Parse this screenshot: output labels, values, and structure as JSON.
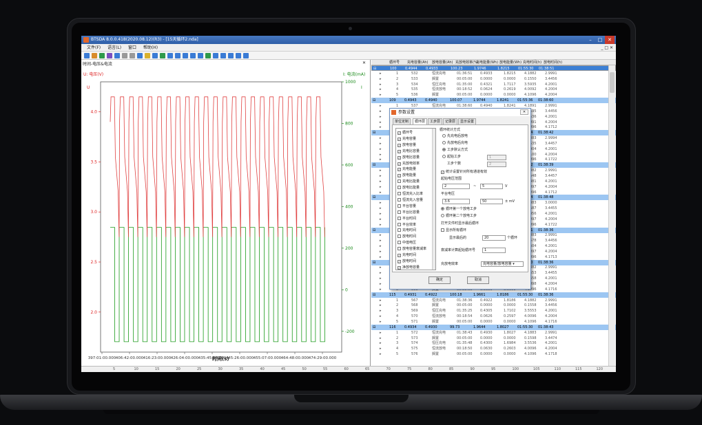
{
  "app": {
    "title": "BTSDA 8.0.0.418(2020.08.12)(R3) - [15天循环2.nda]"
  },
  "window_controls": {
    "minimize": "–",
    "maximize": "□",
    "close": "✕"
  },
  "menu": {
    "items": [
      "文件(F)",
      "语言(L)",
      "窗口",
      "帮助(H)"
    ],
    "right": "_ □ ✕"
  },
  "left_panel": {
    "tab_title": "时间-电压&电流",
    "close": "✕",
    "legend_left": "U: 电压(V)",
    "legend_right": "I: 电流(mA)",
    "x_title": "时间(s)"
  },
  "chart_data": [
    {
      "type": "line",
      "xlabel": "时间(s)",
      "x_ticks": [
        "397:01:00.000",
        "406:42:00.000",
        "416:23:00.000",
        "426:04:00.000",
        "435:45:00.000",
        "445:26:00.000",
        "455:07:00.000",
        "464:48:00.000",
        "474:29:00.000"
      ],
      "y_left_ticks": [
        "4.0",
        "3.5",
        "3.0",
        "2.5",
        "2.0"
      ],
      "y_left_axis_label": "U",
      "y_left_range": [
        1.6,
        4.3
      ],
      "y_right_ticks": [
        "1000",
        "800",
        "600",
        "400",
        "200",
        "0",
        "-200"
      ],
      "y_right_axis_label": "I",
      "y_right_range": [
        -300,
        1000
      ],
      "series": [
        {
          "name": "电压(V)",
          "color": "#e04040",
          "axis": "left",
          "cycles": 23,
          "max": 4.15,
          "min": 2.75
        },
        {
          "name": "电流(mA)",
          "color": "#1a9a1a",
          "axis": "right",
          "cycles": 23,
          "high": 300,
          "low": -250
        }
      ],
      "grid": false
    }
  ],
  "table": {
    "headers": [
      "循环号",
      "充电容量(Ah)",
      "放电容量(Ah)",
      "充放电效率(%)",
      "充电能量(Wh)",
      "放电能量(Wh)",
      "充电时间(h)",
      "放电时间(h)"
    ],
    "rows": [
      {
        "kind": "cycle",
        "sel": true,
        "c": [
          "100",
          "0.4944",
          "0.4933",
          "100.23",
          "1.9746",
          "1.8215",
          "01:55:30",
          "01:38:51"
        ]
      },
      {
        "kind": "step",
        "c": [
          "1",
          "532",
          "恒流充电",
          "01:36:51",
          "0.4933",
          "1.8215",
          "4.1882",
          "2.9991"
        ]
      },
      {
        "kind": "step",
        "c": [
          "2",
          "533",
          "搁置",
          "00:05:00",
          "0.0000",
          "0.0000",
          "0.1550",
          "3.4456"
        ]
      },
      {
        "kind": "step",
        "c": [
          "3",
          "534",
          "恒压充电",
          "01:35:00",
          "0.4321",
          "1.7117",
          "3.5935",
          "4.2001"
        ]
      },
      {
        "kind": "step",
        "c": [
          "4",
          "535",
          "恒流放电",
          "00:18:52",
          "0.0624",
          "0.2619",
          "4.0092",
          "4.2004"
        ]
      },
      {
        "kind": "step",
        "c": [
          "5",
          "536",
          "搁置",
          "00:05:00",
          "0.0000",
          "0.0000",
          "4.1096",
          "4.2004"
        ]
      },
      {
        "kind": "cycle",
        "c": [
          "109",
          "0.4943",
          "0.4940",
          "100.07",
          "1.9744",
          "1.8241",
          "01:55:36",
          "01:38:60"
        ]
      },
      {
        "kind": "step",
        "c": [
          "1",
          "537",
          "恒流充电",
          "01:38:60",
          "0.4940",
          "1.8241",
          "4.1891",
          "2.9991"
        ]
      },
      {
        "kind": "step",
        "c": [
          "2",
          "538",
          "搁置",
          "00:05:00",
          "0.0000",
          "0.0000",
          "0.1595",
          "3.4456"
        ]
      },
      {
        "kind": "step",
        "c": [
          "3",
          "539",
          "恒压充电",
          "01:35:30",
          "0.4316",
          "1.7114",
          "3.5536",
          "4.2001"
        ]
      },
      {
        "kind": "step",
        "c": [
          "4",
          "540",
          "恒流放电",
          "00:18:55",
          "0.0627",
          "0.2630",
          "4.0091",
          "4.2004"
        ]
      },
      {
        "kind": "step",
        "c": [
          "5",
          "541",
          "搁置",
          "00:05:00",
          "0.0000",
          "0.0000",
          "4.1096",
          "4.1712"
        ]
      },
      {
        "kind": "cycle",
        "c": [
          "110",
          "0.4942",
          "0.4938",
          "100.08",
          "1.9743",
          "1.8240",
          "01:55:24",
          "01:38:42"
        ]
      },
      {
        "kind": "step",
        "c": [
          "1",
          "542",
          "恒流充电",
          "01:38:42",
          "0.4938",
          "1.8240",
          "4.1883",
          "2.9994"
        ]
      },
      {
        "kind": "step",
        "c": [
          "2",
          "543",
          "搁置",
          "00:05:00",
          "0.0000",
          "0.0000",
          "0.1535",
          "3.4457"
        ]
      },
      {
        "kind": "step",
        "c": [
          "3",
          "544",
          "恒压充电",
          "01:35:12",
          "0.4315",
          "1.7111",
          "3.5404",
          "4.2001"
        ]
      },
      {
        "kind": "step",
        "c": [
          "4",
          "545",
          "恒流放电",
          "00:18:54",
          "0.0627",
          "0.2615",
          "4.0100",
          "4.2004"
        ]
      },
      {
        "kind": "step",
        "c": [
          "5",
          "546",
          "搁置",
          "00:05:00",
          "0.0000",
          "0.0000",
          "4.1096",
          "4.1722"
        ]
      },
      {
        "kind": "cycle",
        "c": [
          "111",
          "0.4939",
          "0.4935",
          "100.08",
          "1.9740",
          "1.8230",
          "01:55:22",
          "01:38:39"
        ]
      },
      {
        "kind": "step",
        "c": [
          "1",
          "547",
          "恒流充电",
          "01:38:39",
          "0.4935",
          "1.8230",
          "4.1882",
          "2.9991"
        ]
      },
      {
        "kind": "step",
        "c": [
          "2",
          "548",
          "搁置",
          "00:05:00",
          "0.0000",
          "0.0000",
          "0.1548",
          "3.4457"
        ]
      },
      {
        "kind": "step",
        "c": [
          "3",
          "549",
          "恒压充电",
          "01:35:10",
          "0.4313",
          "1.7117",
          "3.5481",
          "4.2001"
        ]
      },
      {
        "kind": "step",
        "c": [
          "4",
          "550",
          "恒流放电",
          "00:18:48",
          "0.0625",
          "0.2617",
          "4.0097",
          "4.2004"
        ]
      },
      {
        "kind": "step",
        "c": [
          "5",
          "551",
          "搁置",
          "00:05:00",
          "0.0000",
          "0.0000",
          "4.1096",
          "4.1712"
        ]
      },
      {
        "kind": "cycle",
        "c": [
          "112",
          "0.4936",
          "0.4934",
          "100.04",
          "1.9738",
          "1.8226",
          "01:55:24",
          "01:38:48"
        ]
      },
      {
        "kind": "step",
        "c": [
          "1",
          "552",
          "恒流充电",
          "01:38:48",
          "0.4934",
          "1.8226",
          "4.1883",
          "3.0000"
        ]
      },
      {
        "kind": "step",
        "c": [
          "2",
          "553",
          "搁置",
          "00:05:00",
          "0.0000",
          "0.0000",
          "0.1587",
          "3.4455"
        ]
      },
      {
        "kind": "step",
        "c": [
          "3",
          "554",
          "恒压充电",
          "01:35:12",
          "0.4310",
          "1.7113",
          "3.5456",
          "4.2001"
        ]
      },
      {
        "kind": "step",
        "c": [
          "4",
          "555",
          "恒流放电",
          "00:18:54",
          "0.0626",
          "0.2615",
          "4.0097",
          "4.2004"
        ]
      },
      {
        "kind": "step",
        "c": [
          "5",
          "556",
          "搁置",
          "00:05:00",
          "0.0000",
          "0.0000",
          "4.1096",
          "4.1722"
        ]
      },
      {
        "kind": "cycle",
        "c": [
          "113",
          "0.4935",
          "0.4931",
          "100.08",
          "1.9735",
          "1.8225",
          "01:55:21",
          "01:38:36"
        ]
      },
      {
        "kind": "step",
        "c": [
          "1",
          "557",
          "恒流充电",
          "01:38:36",
          "0.4931",
          "1.8225",
          "4.1883",
          "2.9991"
        ]
      },
      {
        "kind": "step",
        "c": [
          "2",
          "558",
          "搁置",
          "00:05:00",
          "0.0000",
          "0.0000",
          "0.1578",
          "3.4456"
        ]
      },
      {
        "kind": "step",
        "c": [
          "3",
          "559",
          "恒压充电",
          "01:35:11",
          "0.4309",
          "1.7110",
          "3.5504",
          "4.2001"
        ]
      },
      {
        "kind": "step",
        "c": [
          "4",
          "560",
          "恒流放电",
          "00:18:51",
          "0.0626",
          "0.2618",
          "4.0097",
          "4.2004"
        ]
      },
      {
        "kind": "step",
        "c": [
          "5",
          "561",
          "搁置",
          "00:05:00",
          "0.0000",
          "0.0000",
          "4.1096",
          "4.1713"
        ]
      },
      {
        "kind": "cycle",
        "c": [
          "114",
          "0.4931",
          "0.4929",
          "100.04",
          "1.9731",
          "1.8221",
          "01:55:30",
          "01:38:36"
        ]
      },
      {
        "kind": "step",
        "c": [
          "1",
          "562",
          "恒流充电",
          "01:38:36",
          "0.4929",
          "1.8221",
          "4.1882",
          "2.9991"
        ]
      },
      {
        "kind": "step",
        "c": [
          "2",
          "563",
          "搁置",
          "00:05:00",
          "0.0000",
          "0.0000",
          "0.1553",
          "3.4455"
        ]
      },
      {
        "kind": "step",
        "c": [
          "3",
          "564",
          "恒压充电",
          "01:35:11",
          "0.4307",
          "1.7099",
          "3.5558",
          "4.2001"
        ]
      },
      {
        "kind": "step",
        "c": [
          "4",
          "565",
          "恒流放电",
          "00:18:54",
          "0.0624",
          "0.2612",
          "4.0098",
          "4.2004"
        ]
      },
      {
        "kind": "step",
        "c": [
          "5",
          "566",
          "搁置",
          "00:05:00",
          "0.0000",
          "0.0000",
          "4.1096",
          "4.1716"
        ]
      },
      {
        "kind": "cycle",
        "c": [
          "115",
          "0.4931",
          "0.4922",
          "100.18",
          "1.9661",
          "1.8186",
          "01:55:30",
          "01:38:36"
        ]
      },
      {
        "kind": "step",
        "c": [
          "1",
          "567",
          "恒流充电",
          "01:38:36",
          "0.4922",
          "1.8186",
          "4.1882",
          "2.9991"
        ]
      },
      {
        "kind": "step",
        "c": [
          "2",
          "568",
          "搁置",
          "00:05:00",
          "0.0000",
          "0.0000",
          "0.1558",
          "3.4456"
        ]
      },
      {
        "kind": "step",
        "c": [
          "3",
          "569",
          "恒压充电",
          "01:35:25",
          "0.4305",
          "1.7102",
          "3.5553",
          "4.2001"
        ]
      },
      {
        "kind": "step",
        "c": [
          "4",
          "570",
          "恒流放电",
          "00:18:54",
          "0.0626",
          "0.2597",
          "4.0096",
          "4.2004"
        ]
      },
      {
        "kind": "step",
        "c": [
          "5",
          "571",
          "搁置",
          "00:05:00",
          "0.0000",
          "0.0000",
          "4.1096",
          "4.1716"
        ]
      },
      {
        "kind": "cycle",
        "c": [
          "116",
          "0.4934",
          "0.4930",
          "99.73",
          "1.9644",
          "1.8027",
          "01:55:30",
          "01:38:43"
        ]
      },
      {
        "kind": "step",
        "c": [
          "1",
          "572",
          "恒流充电",
          "01:38:43",
          "0.4930",
          "1.8027",
          "4.1883",
          "2.9991"
        ]
      },
      {
        "kind": "step",
        "c": [
          "2",
          "573",
          "搁置",
          "00:05:00",
          "0.0000",
          "0.0000",
          "0.1598",
          "3.4474"
        ]
      },
      {
        "kind": "step",
        "c": [
          "3",
          "574",
          "恒压充电",
          "01:35:48",
          "0.4300",
          "1.6984",
          "3.5536",
          "4.2001"
        ]
      },
      {
        "kind": "step",
        "c": [
          "4",
          "575",
          "恒流放电",
          "00:18:50",
          "0.0630",
          "0.2603",
          "4.0096",
          "4.2004"
        ]
      },
      {
        "kind": "step",
        "c": [
          "5",
          "576",
          "搁置",
          "00:05:00",
          "0.0000",
          "0.0000",
          "4.1096",
          "4.1718"
        ]
      }
    ]
  },
  "ruler": {
    "labels": [
      "5",
      "10",
      "15",
      "20",
      "25",
      "30",
      "35",
      "40",
      "45",
      "50",
      "55",
      "60",
      "65",
      "70",
      "75",
      "80",
      "85",
      "90",
      "95",
      "100",
      "105",
      "110",
      "115",
      "120",
      "125"
    ]
  },
  "dialog": {
    "title": "参数设置",
    "close": "✕",
    "tabs": [
      "单位定制",
      "循环层",
      "工步层",
      "记录层",
      "显示设置"
    ],
    "columns": [
      "循环号",
      "充电容量",
      "放电容量",
      "充电比容量",
      "放电比容量",
      "充放电效率",
      "充电能量",
      "放电能量",
      "充电比能量",
      "放电比能量",
      "恒流充入比率",
      "恒流充入容量",
      "平台容量",
      "平台比容量",
      "平台时间",
      "平台效率",
      "充电时间",
      "放电时间",
      "中值电压",
      "放电容量衰减率",
      "充电时间",
      "放电时间",
      "净放电容量"
    ],
    "checked": [
      true,
      true,
      true,
      true,
      true,
      true,
      true,
      true,
      false,
      false,
      false,
      false,
      false,
      false,
      false,
      false,
      false,
      false,
      false,
      false,
      true,
      true,
      true
    ],
    "group1_label": "循环统计方式",
    "group1_options": [
      "先充电后放电",
      "先放电后充电",
      "工步默认方式",
      "起始工步"
    ],
    "group1_selected": 2,
    "start_step": "1",
    "step_count_label": "工步个数",
    "step_count": "2",
    "apply_all": "统计设置针对所有通道有效",
    "voltage_range_label": "起始电压范围",
    "v_from": "2",
    "v_sep": "~",
    "v_to": "5",
    "v_unit": "V",
    "platform_label": "平台电压",
    "platform_v": "3.6",
    "platform_tol": "50",
    "platform_tol_unit": "± mV",
    "platform_options": [
      "循环第一个放电工步",
      "循环第二个放电工步"
    ],
    "platform_selected": 0,
    "open_last": "打开文件时显示最后循环",
    "show_all": "显示所有循环",
    "show_last_label": "显示最后的",
    "show_last_value": "20",
    "show_last_unit": "个循环",
    "decay_label": "衰减率计算起始循环号",
    "decay_value": "1",
    "efficiency_label": "充放电效率",
    "efficiency_value": "充电容量/放电容量",
    "ok": "确定",
    "cancel": "取消"
  },
  "colors": {
    "accent": "#3b7fd4",
    "voltage": "#e04040",
    "current": "#1a9a1a"
  }
}
